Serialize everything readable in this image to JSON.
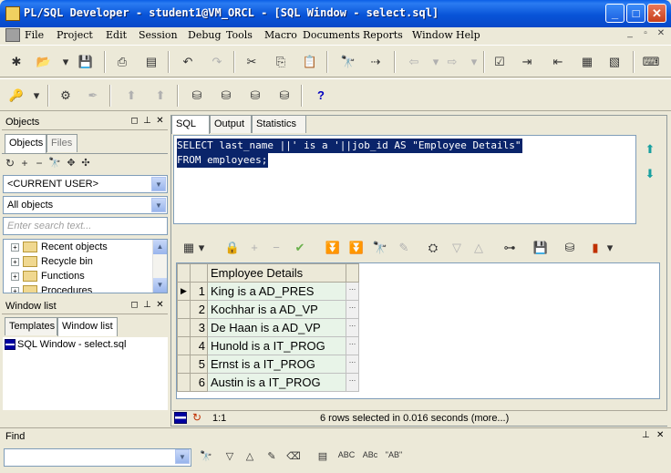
{
  "window": {
    "title": "PL/SQL Developer - student1@VM_ORCL - [SQL Window - select.sql]",
    "min": "_",
    "max": "□",
    "close": "✕"
  },
  "menu": [
    "File",
    "Project",
    "Edit",
    "Session",
    "Debug",
    "Tools",
    "Macro",
    "Documents",
    "Reports",
    "Window",
    "Help"
  ],
  "mdi_controls": [
    "_",
    "▫",
    "✕"
  ],
  "objects_panel": {
    "title": "Objects",
    "tabs": [
      "Objects",
      "Files"
    ],
    "user_combo": "<CURRENT USER>",
    "filter_combo": "All objects",
    "search_placeholder": "Enter search text...",
    "tree": [
      "Recent objects",
      "Recycle bin",
      "Functions",
      "Procedures"
    ]
  },
  "window_list_panel": {
    "title": "Window list",
    "tabs": [
      "Templates",
      "Window list"
    ],
    "items": [
      "SQL Window - select.sql"
    ]
  },
  "sql_window": {
    "tabs": [
      "SQL",
      "Output",
      "Statistics"
    ],
    "sql_lines": [
      "SELECT last_name ||' is a '||job_id AS \"Employee Details\"",
      "FROM employees;"
    ]
  },
  "results": {
    "column": "Employee Details",
    "rows": [
      {
        "n": "1",
        "v": "King is a AD_PRES"
      },
      {
        "n": "2",
        "v": "Kochhar is a AD_VP"
      },
      {
        "n": "3",
        "v": "De Haan is a AD_VP"
      },
      {
        "n": "4",
        "v": "Hunold is a IT_PROG"
      },
      {
        "n": "5",
        "v": "Ernst is a IT_PROG"
      },
      {
        "n": "6",
        "v": "Austin is a IT_PROG"
      }
    ],
    "ellipsis": "..."
  },
  "status": {
    "position": "1:1",
    "message": "6 rows selected in 0.016 seconds (more...)"
  },
  "find": {
    "title": "Find",
    "abc": "ABC",
    "abc2": "ABc",
    "ab_quoted": "\"AB\""
  }
}
